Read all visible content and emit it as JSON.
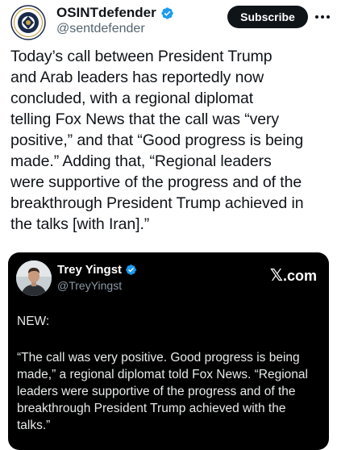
{
  "post": {
    "author": {
      "display_name": "OSINTdefender",
      "handle": "@sentdefender",
      "verified": true,
      "avatar_icon": "osintdefender-logo"
    },
    "subscribe_label": "Subscribe",
    "text_lines": [
      "Today’s call between President Trump",
      "and Arab leaders has reportedly now",
      "concluded, with a regional diplomat",
      "telling Fox News that the call was “very",
      "positive,” and that “Good progress is being",
      "made.” Adding that, “Regional leaders",
      "were supportive of the progress and of the",
      "breakthrough President Trump achieved in",
      "the talks [with Iran].”"
    ]
  },
  "quote": {
    "author": {
      "display_name": "Trey Yingst",
      "handle": "@TreyYingst",
      "verified": true
    },
    "source_label": ".com",
    "source_icon": "x-logo-icon",
    "lead": "NEW:",
    "body_lines": [
      "“The call was very positive. Good progress is being",
      "made,” a regional diplomat told Fox News. “Regional",
      "leaders were supportive of the progress and of the",
      "breakthrough President Trump achieved with the",
      "talks.”"
    ]
  },
  "colors": {
    "text": "#0f1419",
    "secondary": "#536471",
    "verified": "#1d9bf0",
    "quote_bg": "#000000"
  }
}
